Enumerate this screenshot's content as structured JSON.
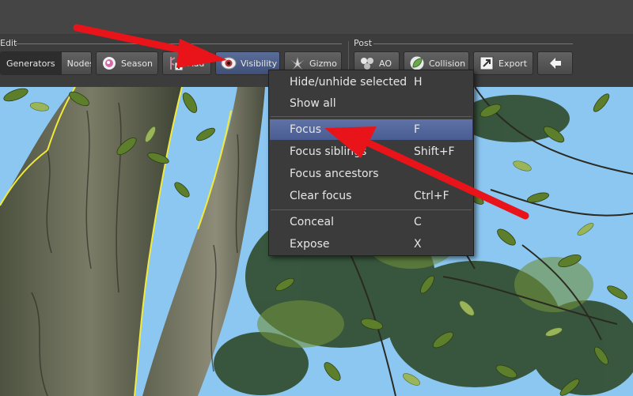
{
  "toolbar": {
    "edit_label": "Edit",
    "post_label": "Post",
    "generators": "Generators",
    "nodes": "Nodes",
    "season": "Season",
    "add": "Add",
    "visibility": "Visibility",
    "gizmo": "Gizmo",
    "ao": "AO",
    "collision": "Collision",
    "export": "Export"
  },
  "menu": {
    "items": [
      {
        "label": "Hide/unhide selected",
        "shortcut": "H"
      },
      {
        "label": "Show all",
        "shortcut": ""
      },
      {
        "label": "Focus",
        "shortcut": "F"
      },
      {
        "label": "Focus siblings",
        "shortcut": "Shift+F"
      },
      {
        "label": "Focus ancestors",
        "shortcut": ""
      },
      {
        "label": "Clear focus",
        "shortcut": "Ctrl+F"
      },
      {
        "label": "Conceal",
        "shortcut": "C"
      },
      {
        "label": "Expose",
        "shortcut": "X"
      }
    ],
    "highlighted": "Focus"
  },
  "colors": {
    "annotation_arrow": "#e8141a",
    "selection_outline": "#f2ea3a",
    "menu_highlight": "#5468a0",
    "sky": "#8cc7f2"
  },
  "icons": [
    "season-icon",
    "add-node-icon",
    "eye-icon",
    "gizmo-icon",
    "ao-icon",
    "collision-leaf-icon",
    "export-icon",
    "back-arrow-icon"
  ]
}
